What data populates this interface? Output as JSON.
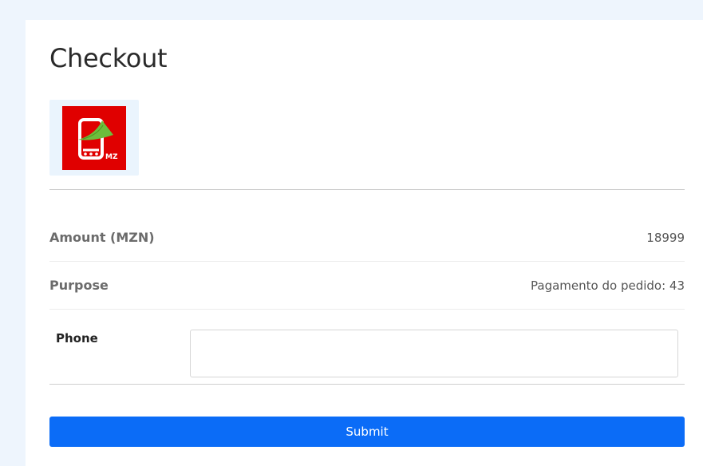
{
  "page": {
    "title": "Checkout"
  },
  "logo": {
    "icon": "mobile-payment-icon",
    "text": "MZ",
    "colors": {
      "background": "#e00000",
      "leaf": "#6cbe3c"
    }
  },
  "details": {
    "amount_label": "Amount (MZN)",
    "amount_value": "18999",
    "purpose_label": "Purpose",
    "purpose_value": "Pagamento do pedido: 43"
  },
  "form": {
    "phone_label": "Phone",
    "phone_value": "",
    "submit_label": "Submit"
  },
  "colors": {
    "accent": "#0b6cf7",
    "page_background": "#eef5fd"
  }
}
